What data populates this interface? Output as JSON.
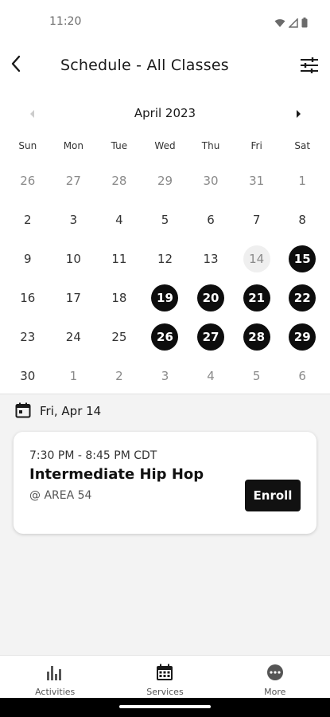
{
  "status": {
    "time": "11:20",
    "icons": [
      "wifi-icon",
      "signal-icon",
      "battery-icon"
    ]
  },
  "header": {
    "title": "Schedule - All Classes",
    "back_icon": "back-arrow-icon",
    "filter_icon": "filter-sliders-icon"
  },
  "calendar": {
    "month": "April 2023",
    "weekdays": [
      "Sun",
      "Mon",
      "Tue",
      "Wed",
      "Thu",
      "Fri",
      "Sat"
    ],
    "weeks": [
      [
        {
          "d": "26",
          "state": "muted"
        },
        {
          "d": "27",
          "state": "muted"
        },
        {
          "d": "28",
          "state": "muted"
        },
        {
          "d": "29",
          "state": "muted"
        },
        {
          "d": "30",
          "state": "muted"
        },
        {
          "d": "31",
          "state": "muted"
        },
        {
          "d": "1",
          "state": "muted"
        }
      ],
      [
        {
          "d": "2",
          "state": "normal"
        },
        {
          "d": "3",
          "state": "normal"
        },
        {
          "d": "4",
          "state": "normal"
        },
        {
          "d": "5",
          "state": "normal"
        },
        {
          "d": "6",
          "state": "normal"
        },
        {
          "d": "7",
          "state": "normal"
        },
        {
          "d": "8",
          "state": "normal"
        }
      ],
      [
        {
          "d": "9",
          "state": "normal"
        },
        {
          "d": "10",
          "state": "normal"
        },
        {
          "d": "11",
          "state": "normal"
        },
        {
          "d": "12",
          "state": "normal"
        },
        {
          "d": "13",
          "state": "normal"
        },
        {
          "d": "14",
          "state": "selected"
        },
        {
          "d": "15",
          "state": "event"
        }
      ],
      [
        {
          "d": "16",
          "state": "normal"
        },
        {
          "d": "17",
          "state": "normal"
        },
        {
          "d": "18",
          "state": "normal"
        },
        {
          "d": "19",
          "state": "event"
        },
        {
          "d": "20",
          "state": "event"
        },
        {
          "d": "21",
          "state": "event"
        },
        {
          "d": "22",
          "state": "event"
        }
      ],
      [
        {
          "d": "23",
          "state": "normal"
        },
        {
          "d": "24",
          "state": "normal"
        },
        {
          "d": "25",
          "state": "normal"
        },
        {
          "d": "26",
          "state": "event"
        },
        {
          "d": "27",
          "state": "event"
        },
        {
          "d": "28",
          "state": "event"
        },
        {
          "d": "29",
          "state": "event"
        }
      ],
      [
        {
          "d": "30",
          "state": "normal"
        },
        {
          "d": "1",
          "state": "muted"
        },
        {
          "d": "2",
          "state": "muted"
        },
        {
          "d": "3",
          "state": "muted"
        },
        {
          "d": "4",
          "state": "muted"
        },
        {
          "d": "5",
          "state": "muted"
        },
        {
          "d": "6",
          "state": "muted"
        }
      ]
    ]
  },
  "selected_date": {
    "label": "Fri, Apr 14",
    "icon": "calendar-icon"
  },
  "classes": [
    {
      "time": "7:30 PM - 8:45 PM CDT",
      "name": "Intermediate Hip Hop",
      "location": "@ AREA 54",
      "action": "Enroll"
    }
  ],
  "bottom_nav": [
    {
      "label": "Activities",
      "icon": "bar-chart-icon"
    },
    {
      "label": "Services",
      "icon": "calendar-grid-icon"
    },
    {
      "label": "More",
      "icon": "more-dots-icon"
    }
  ],
  "colors": {
    "accent": "#0d0d0d",
    "background": "#f3f3f3",
    "selected_day": "#efefef"
  }
}
